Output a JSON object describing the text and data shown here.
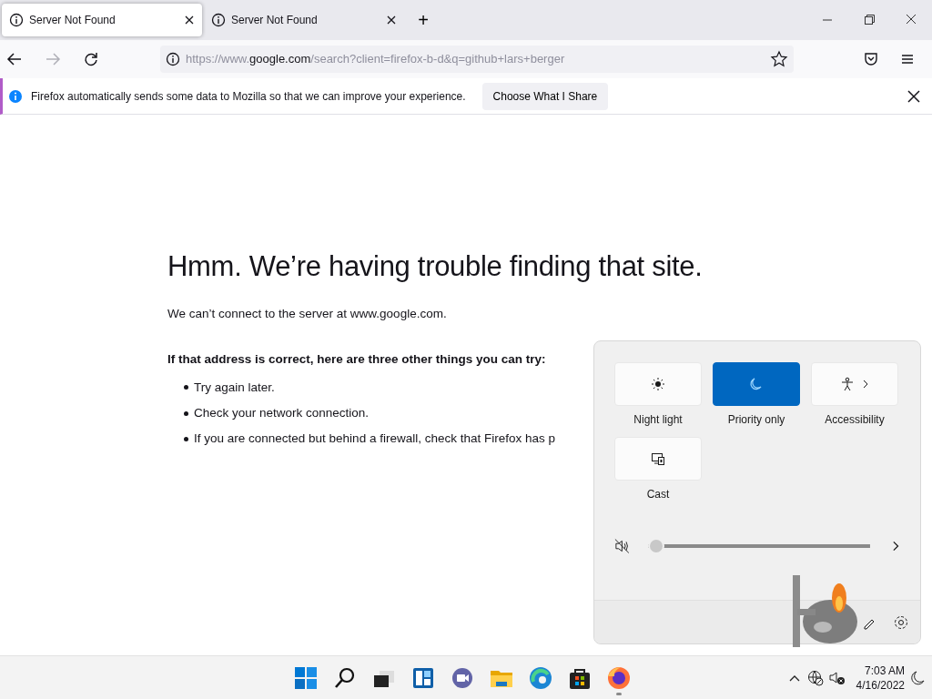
{
  "tabs": [
    {
      "title": "Server Not Found",
      "selected": true
    },
    {
      "title": "Server Not Found",
      "selected": false
    }
  ],
  "new_tab": "+",
  "address_bar": {
    "prefix": "https://www.",
    "host": "google.com",
    "path": "/search?client=firefox-b-d&q=github+lars+berger"
  },
  "notification": {
    "message": "Firefox automatically sends some data to Mozilla so that we can improve your experience.",
    "button": "Choose What I Share"
  },
  "error_page": {
    "title": "Hmm. We’re having trouble finding that site.",
    "description": "We can’t connect to the server at www.google.com.",
    "suggestions_heading": "If that address is correct, here are three other things you can try:",
    "suggestions": [
      "Try again later.",
      "Check your network connection.",
      "If you are connected but behind a firewall, check that Firefox has p"
    ]
  },
  "quick_settings": {
    "tiles": [
      {
        "label": "Night light",
        "kind": "sun",
        "on": false,
        "chevron": false
      },
      {
        "label": "Priority only",
        "kind": "moon",
        "on": true,
        "chevron": false
      },
      {
        "label": "Accessibility",
        "kind": "person",
        "on": false,
        "chevron": true
      },
      {
        "label": "Cast",
        "kind": "cast",
        "on": false,
        "chevron": false
      }
    ],
    "volume": {
      "muted": true,
      "level": 0
    }
  },
  "taskbar": {
    "apps": [
      {
        "kind": "start",
        "running": false
      },
      {
        "kind": "search",
        "running": false
      },
      {
        "kind": "taskview",
        "running": false
      },
      {
        "kind": "widgets",
        "running": false
      },
      {
        "kind": "chat",
        "running": false
      },
      {
        "kind": "explorer",
        "running": false
      },
      {
        "kind": "edge",
        "running": false
      },
      {
        "kind": "store",
        "running": false
      },
      {
        "kind": "firefox",
        "running": true
      }
    ],
    "time": "7:03 AM",
    "date": "4/16/2022"
  }
}
